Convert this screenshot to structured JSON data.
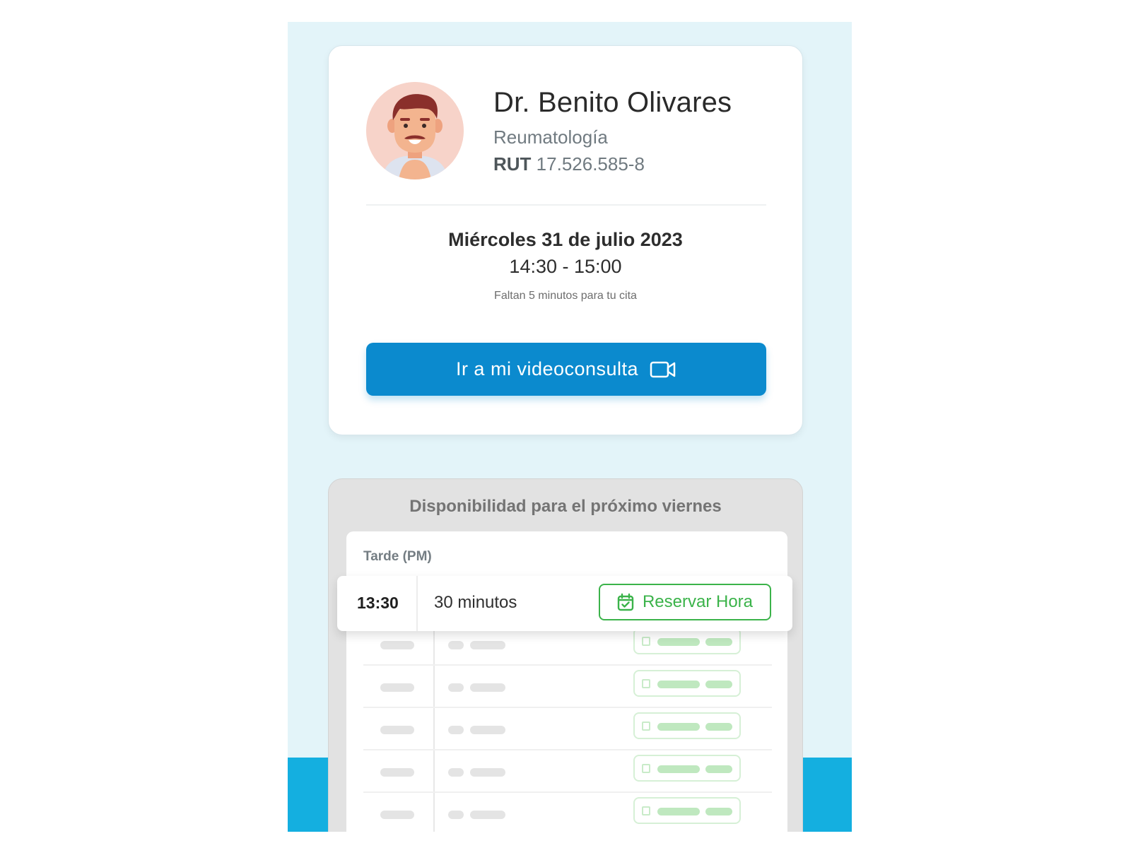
{
  "doctor": {
    "name": "Dr. Benito Olivares",
    "specialty": "Reumatología",
    "rut_label": "RUT",
    "rut_value": "17.526.585-8"
  },
  "appointment": {
    "date": "Miércoles 31 de julio 2023",
    "time": "14:30 - 15:00",
    "remaining": "Faltan 5 minutos para tu cita",
    "video_button": "Ir a mi videoconsulta",
    "video_icon": "video-camera-icon"
  },
  "availability": {
    "title": "Disponibilidad para el próximo viernes",
    "section": "Tarde (PM)",
    "slot": {
      "time": "13:30",
      "duration": "30 minutos",
      "reserve_label": "Reservar Hora",
      "reserve_icon": "calendar-check-icon"
    }
  },
  "colors": {
    "background": "#e3f4f9",
    "primary": "#0b8ace",
    "accent_bottom": "#14afe0",
    "success": "#3bb34a"
  }
}
